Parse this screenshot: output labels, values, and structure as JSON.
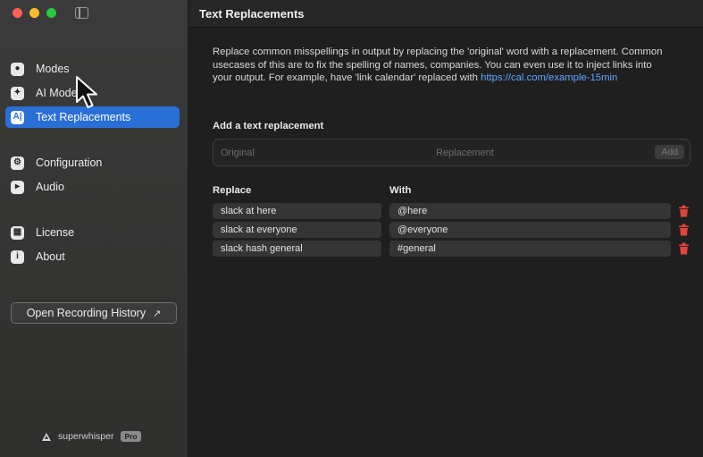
{
  "app": {
    "name": "superwhisper",
    "badge": "Pro"
  },
  "colors": {
    "accent": "#2a6fd6",
    "link": "#5fa8ff",
    "delete": "#e0443c"
  },
  "sidebar": {
    "items": [
      {
        "label": "Modes",
        "icon": "modes-icon",
        "active": false
      },
      {
        "label": "AI Mode",
        "icon": "ai-mode-icon",
        "active": false
      },
      {
        "label": "Text Replacements",
        "icon": "text-replacements-icon",
        "active": true
      },
      {
        "label": "Configuration",
        "icon": "gear-icon",
        "active": false
      },
      {
        "label": "Audio",
        "icon": "speaker-icon",
        "active": false
      },
      {
        "label": "License",
        "icon": "license-icon",
        "active": false
      },
      {
        "label": "About",
        "icon": "info-icon",
        "active": false
      }
    ],
    "history_button": "Open Recording History"
  },
  "main": {
    "title": "Text Replacements",
    "description": "Replace common misspellings in output by replacing the 'original' word with a replacement. Common usecases of this are to fix the spelling of names, companies. You can even use it to inject links into your output. For example, have 'link calendar' replaced with ",
    "description_link": "https://cal.com/example-15min",
    "add_section_label": "Add a text replacement",
    "original_placeholder": "Original",
    "replacement_placeholder": "Replacement",
    "add_button": "Add",
    "columns": {
      "replace": "Replace",
      "with": "With"
    },
    "replacements": [
      {
        "replace": "slack at here",
        "with": "@here"
      },
      {
        "replace": "slack at everyone",
        "with": "@everyone"
      },
      {
        "replace": "slack hash general",
        "with": "#general"
      }
    ]
  }
}
